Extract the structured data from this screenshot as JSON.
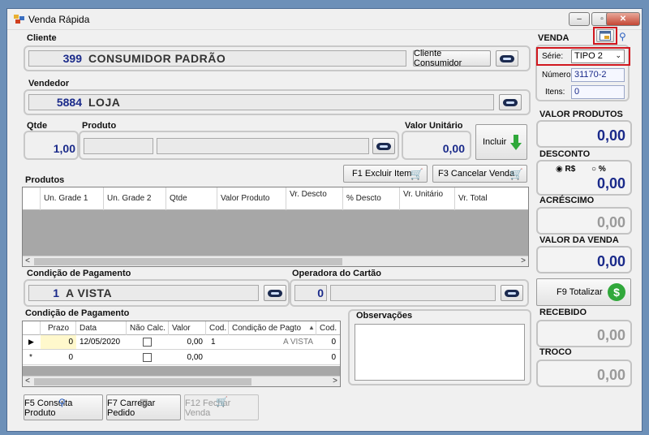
{
  "window": {
    "title": "Venda Rápida",
    "minimize": "–",
    "maximize": "▫",
    "close": "✕"
  },
  "cliente": {
    "label": "Cliente",
    "code": "399",
    "name": "CONSUMIDOR PADRÃO",
    "button": "Cliente Consumidor"
  },
  "vendedor": {
    "label": "Vendedor",
    "code": "5884",
    "name": "LOJA"
  },
  "item": {
    "qtde_label": "Qtde",
    "qtde": "1,00",
    "produto_label": "Produto",
    "valor_unit_label": "Valor Unitário",
    "valor_unit": "0,00",
    "incluir": "Incluir"
  },
  "produtos": {
    "label": "Produtos",
    "excluir": "F1 Excluir Item",
    "cancelar": "F3 Cancelar Venda",
    "columns": [
      "Un. Grade 1",
      "Un. Grade 2",
      "Qtde",
      "Valor Produto",
      "Vr. Descto",
      "% Descto",
      "Vr. Unitário",
      "Vr. Total"
    ]
  },
  "pagamento": {
    "label": "Condição de Pagamento",
    "code": "1",
    "name": "A VISTA"
  },
  "operadora": {
    "label": "Operadora do Cartão",
    "code": "0"
  },
  "parcelas": {
    "label": "Condição de Pagamento",
    "columns": [
      "Prazo",
      "Data",
      "Não Calc.",
      "Valor",
      "Cod.",
      "Condição de Pagto",
      "Cod."
    ],
    "rows": [
      {
        "prazo": "0",
        "data": "12/05/2020",
        "valor": "0,00",
        "cod": "1",
        "condicao": "A VISTA",
        "cod2": "0"
      },
      {
        "prazo": "0",
        "data": "",
        "valor": "0,00",
        "cod": "",
        "condicao": "",
        "cod2": "0"
      }
    ]
  },
  "observacoes": {
    "label": "Observações"
  },
  "footer": {
    "consulta": "F5 Consulta Produto",
    "carregar": "F7 Carregar Pedido",
    "fechar": "F12 Fechar Venda"
  },
  "venda": {
    "label": "VENDA",
    "serie_label": "Série:",
    "serie": "TIPO 2",
    "numero_label": "Número:",
    "numero": "31170-2",
    "itens_label": "Itens:",
    "itens": "0",
    "valor_produtos_label": "VALOR PRODUTOS",
    "valor_produtos": "0,00",
    "desconto_label": "DESCONTO",
    "desconto_rs": "R$",
    "desconto_pct": "%",
    "desconto": "0,00",
    "acrescimo_label": "ACRÉSCIMO",
    "acrescimo": "0,00",
    "valor_venda_label": "VALOR DA VENDA",
    "valor_venda": "0,00",
    "totalizar": "F9 Totalizar",
    "recebido_label": "RECEBIDO",
    "recebido": "0,00",
    "troco_label": "TROCO",
    "troco": "0,00"
  },
  "colors": {
    "value_blue": "#1a2a8a",
    "highlight_red": "#d1181f"
  }
}
